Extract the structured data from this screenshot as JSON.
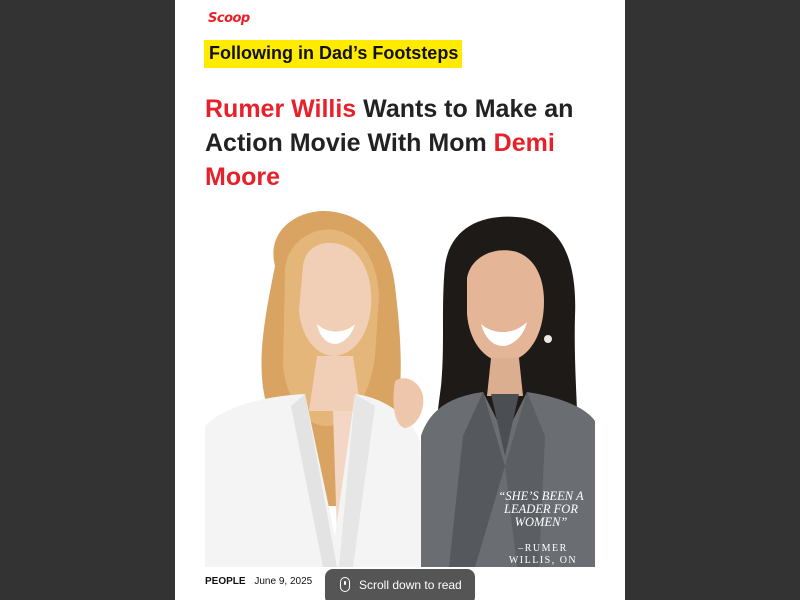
{
  "brand": {
    "label": "Scoop",
    "color": "#e8202a"
  },
  "kicker": {
    "label": "Following in Dad’s Footsteps",
    "highlight": "#ffeb00"
  },
  "headline": {
    "name1": "Rumer Willis",
    "middle": " Wants to Make an Action Movie With Mom ",
    "name2": "Demi Moore"
  },
  "photo": {
    "quote": "“SHE’S BEEN A LEADER FOR WOMEN”",
    "attribution": "–RUMER WILLIS, ON HER MOM",
    "icon": "portrait-photo"
  },
  "byline": {
    "source": "PEOPLE",
    "date": "June 9, 2025"
  },
  "scroll_prompt": {
    "label": "Scroll down to read",
    "icon": "mouse-icon"
  }
}
